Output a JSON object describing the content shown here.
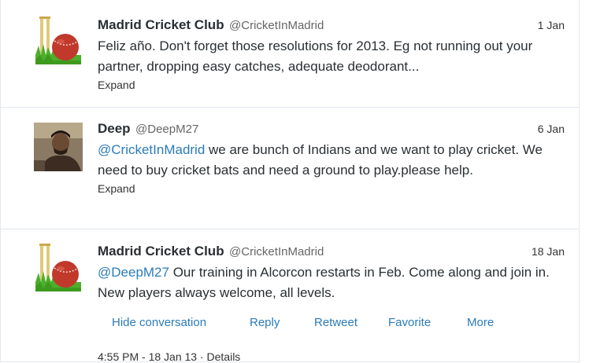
{
  "tweets": [
    {
      "fullname": "Madrid Cricket Club",
      "username": "@CricketInMadrid",
      "time": "1 Jan",
      "text": "Feliz año. Don't forget those resolutions for 2013. Eg not running out your partner, dropping easy catches, adequate deodorant...",
      "expand": "Expand",
      "avatar": "cricket-ball-stumps-logo"
    },
    {
      "fullname": "Deep",
      "username": "@DeepM27",
      "time": "6 Jan",
      "mention": "@CricketInMadrid",
      "text": " we are bunch of Indians and we want to play cricket. We need to buy cricket bats and need a ground to play.please help.",
      "expand": "Expand",
      "avatar": "user-photo"
    },
    {
      "fullname": "Madrid Cricket Club",
      "username": "@CricketInMadrid",
      "time": "18 Jan",
      "mention": "@DeepM27",
      "text": " Our training in Alcorcon restarts in Feb. Come along and join in. New players always welcome, all levels.",
      "actions": {
        "hide_conversation": "Hide conversation",
        "reply": "Reply",
        "retweet": "Retweet",
        "favorite": "Favorite",
        "more": "More"
      },
      "meta": "4:55 PM - 18 Jan 13 · Details",
      "avatar": "cricket-ball-stumps-logo"
    }
  ],
  "colors": {
    "link": "#2b7bb9",
    "ball": "#c0392b",
    "grass": "#4caf2a",
    "stumps": "#e8d9a0"
  }
}
